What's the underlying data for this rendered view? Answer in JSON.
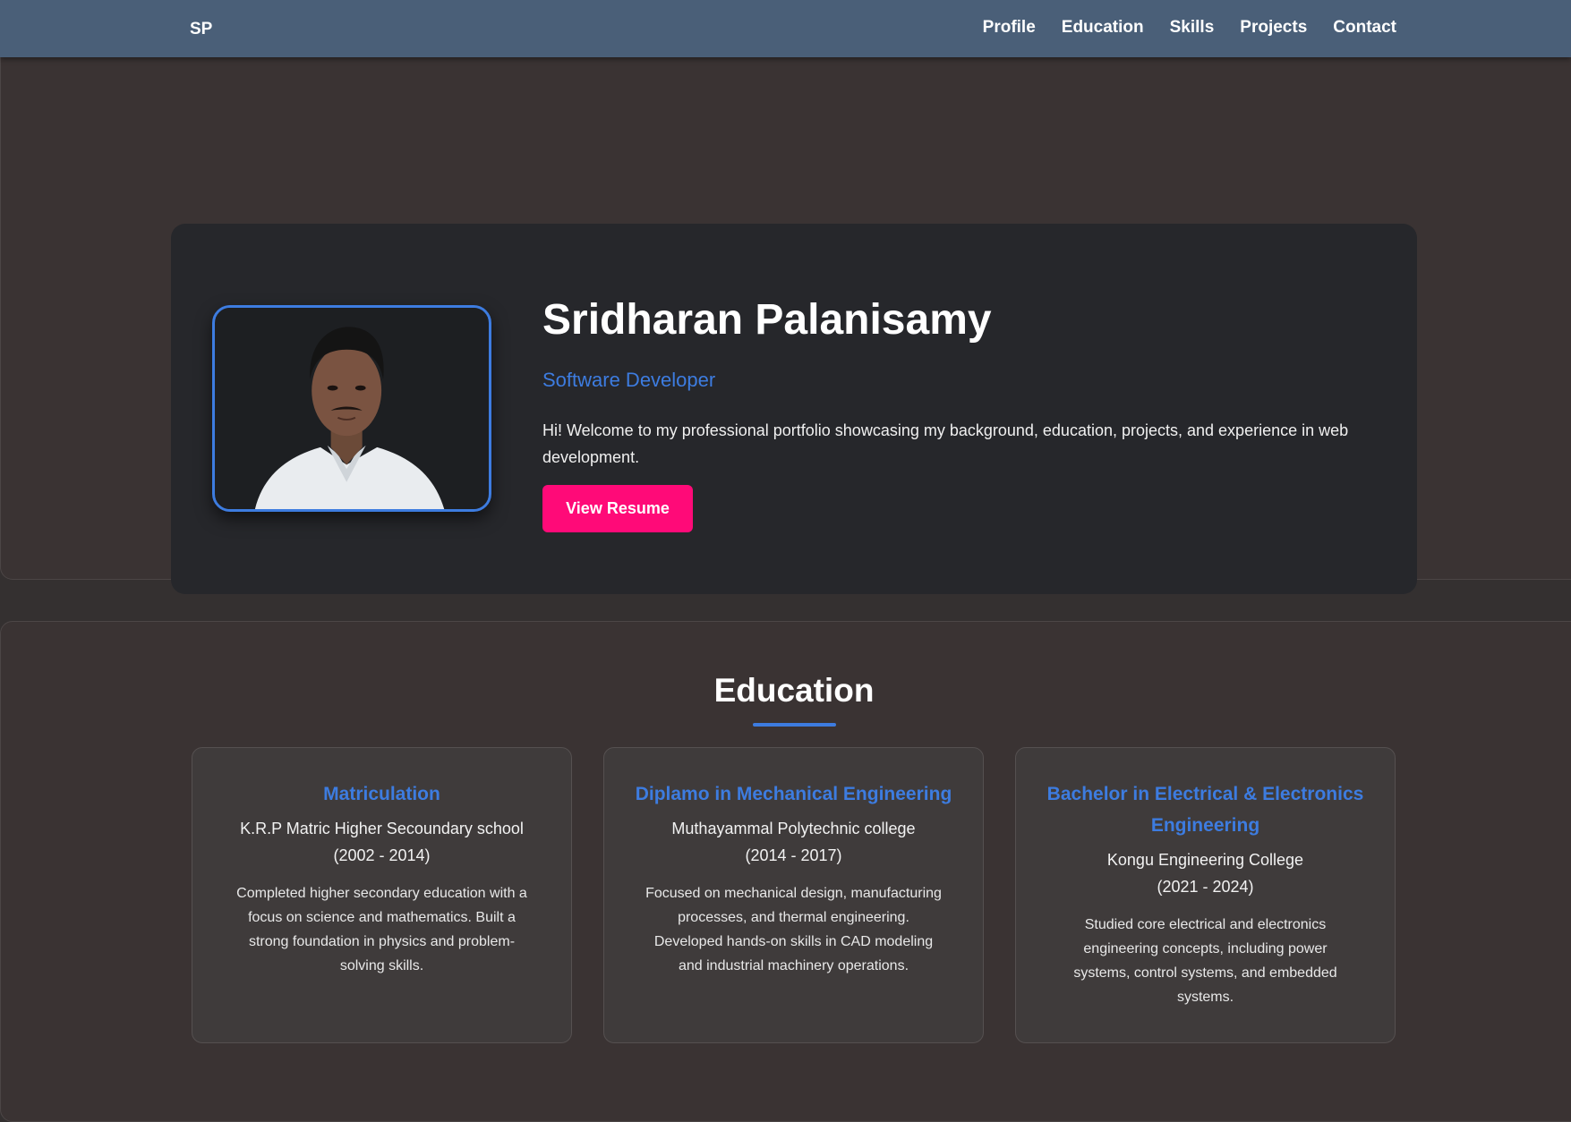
{
  "navbar": {
    "brand": "SP",
    "links": [
      "Profile",
      "Education",
      "Skills",
      "Projects",
      "Contact"
    ]
  },
  "profile": {
    "name": "Sridharan Palanisamy",
    "role": "Software Developer",
    "intro": "Hi! Welcome to my professional portfolio showcasing my background, education, projects, and experience in web development.",
    "resume_button": "View Resume",
    "photo_icon": "profile-photo"
  },
  "education": {
    "heading": "Education",
    "cards": [
      {
        "title": "Matriculation",
        "school": "K.R.P Matric Higher Secoundary school",
        "years": "(2002 - 2014)",
        "description": "Completed higher secondary education with a focus on science and mathematics. Built a strong foundation in physics and problem-solving skills."
      },
      {
        "title": "Diplamo in Mechanical Engineering",
        "school": "Muthayammal Polytechnic college",
        "years": "(2014 - 2017)",
        "description": "Focused on mechanical design, manufacturing processes, and thermal engineering. Developed hands-on skills in CAD modeling and industrial machinery operations."
      },
      {
        "title": "Bachelor in Electrical & Electronics Engineering",
        "school": "Kongu Engineering College",
        "years": "(2021 - 2024)",
        "description": "Studied core electrical and electronics engineering concepts, including power systems, control systems, and embedded systems."
      }
    ]
  },
  "colors": {
    "navbar": "#4a5f78",
    "accent": "#3d7ce0",
    "button": "#ff0a78",
    "card": "#26272b",
    "section": "#3a3333"
  }
}
